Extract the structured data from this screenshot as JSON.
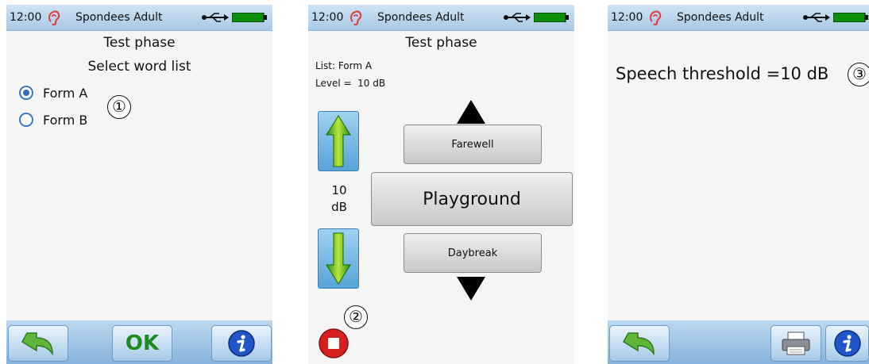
{
  "status_bar": {
    "time": "12:00",
    "profile": "Spondees Adult",
    "icons": [
      "ear-icon",
      "usb-icon",
      "battery-icon"
    ],
    "battery_color": "#0a8f0a"
  },
  "screen1": {
    "title": "Test phase",
    "subtitle": "Select word list",
    "options": [
      {
        "label": "Form A",
        "selected": true
      },
      {
        "label": "Form B",
        "selected": false
      }
    ],
    "marker": "①",
    "bottom": {
      "back_icon": "back-arrow-icon",
      "ok_label": "OK",
      "info_icon": "info-icon"
    }
  },
  "screen2": {
    "title": "Test phase",
    "list_label": "List: Form A",
    "level_label": "Level =  10 dB",
    "level_value": "10",
    "level_unit": "dB",
    "words": {
      "previous": "Farewell",
      "current": "Playground",
      "next": "Daybreak"
    },
    "marker": "②",
    "icons": [
      "level-up-icon",
      "level-down-icon",
      "scroll-up-icon",
      "scroll-down-icon",
      "stop-icon"
    ]
  },
  "screen3": {
    "result": "Speech threshold =10 dB",
    "marker": "③",
    "bottom": {
      "back_icon": "back-arrow-icon",
      "print_icon": "printer-icon",
      "info_icon": "info-icon"
    }
  },
  "colors": {
    "status_bar": "#b7d3ec",
    "bottom_bar": "#9fc4e6",
    "radio_accent": "#2f6fc0",
    "ok_green": "#1f8a1f",
    "arrow_green": "#4caf1e",
    "stop_red": "#d61f1f",
    "info_blue": "#1f55c8"
  }
}
